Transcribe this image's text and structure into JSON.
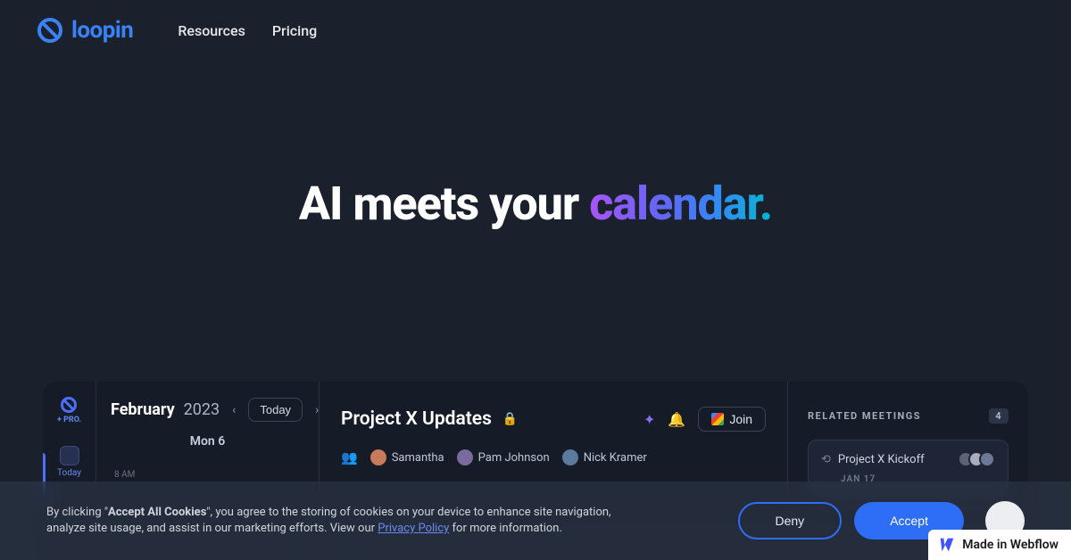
{
  "brand": {
    "name": "loopin"
  },
  "nav": {
    "items": [
      "Resources",
      "Pricing"
    ]
  },
  "hero": {
    "prefix": "AI meets your ",
    "highlight": "calendar."
  },
  "preview": {
    "pro_label": "+ PRO.",
    "today_label": "Today",
    "calendar": {
      "month": "February",
      "year": "2023",
      "today_button": "Today",
      "day_header": "Mon 6",
      "hour_label": "8 AM"
    },
    "main": {
      "title": "Project X Updates",
      "join_label": "Join",
      "attendees": [
        "Samantha",
        "Pam Johnson",
        "Nick Kramer"
      ]
    },
    "related": {
      "header": "RELATED MEETINGS",
      "count": "4",
      "item_title": "Project X Kickoff",
      "item_date": "JAN 17"
    }
  },
  "cookies": {
    "prefix": "By clicking \"",
    "bold": "Accept All Cookies",
    "middle": "\", you agree to the storing of cookies on your device to enhance site navigation, analyze site usage, and assist in our marketing efforts. View our ",
    "link": "Privacy Policy",
    "suffix": " for more information.",
    "deny": "Deny",
    "accept": "Accept"
  },
  "webflow": {
    "text": "Made in Webflow"
  }
}
